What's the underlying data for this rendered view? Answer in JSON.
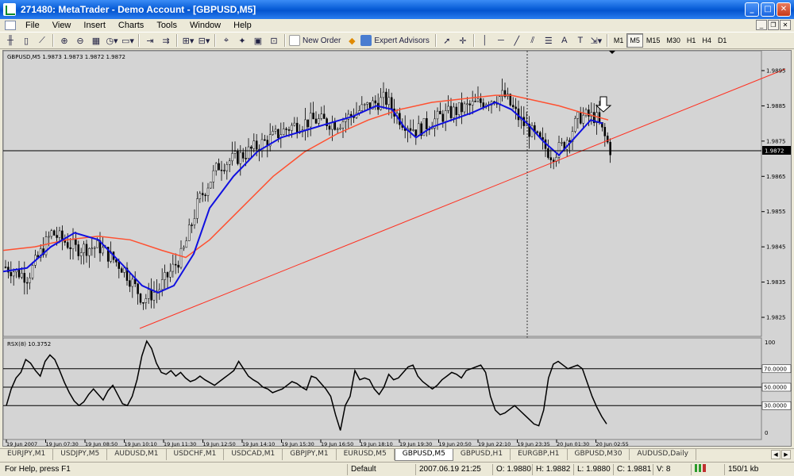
{
  "window": {
    "title": "271480: MetaTrader - Demo Account - [GBPUSD,M5]"
  },
  "menu": [
    "File",
    "View",
    "Insert",
    "Charts",
    "Tools",
    "Window",
    "Help"
  ],
  "toolbar": {
    "new_order_label": "New Order",
    "expert_advisors_label": "Expert Advisors",
    "text_tool": "A",
    "label_tool": "T",
    "timeframes": [
      "M1",
      "M5",
      "M15",
      "M30",
      "H1",
      "H4",
      "D1"
    ],
    "active_timeframe": "M5"
  },
  "chart": {
    "info": "GBPUSD,M5  1.9873 1.9873 1.9872 1.9872",
    "current_price": "1.9872",
    "price_labels": [
      {
        "label": "1.9895",
        "value": 1.9895
      },
      {
        "label": "1.9885",
        "value": 1.9885
      },
      {
        "label": "1.9875",
        "value": 1.9875
      },
      {
        "label": "1.9865",
        "value": 1.9865
      },
      {
        "label": "1.9855",
        "value": 1.9855
      },
      {
        "label": "1.9845",
        "value": 1.9845
      },
      {
        "label": "1.9835",
        "value": 1.9835
      },
      {
        "label": "1.9825",
        "value": 1.9825
      }
    ],
    "time_labels": [
      "19 Jun 2007",
      "19 Jun 07:30",
      "19 Jun 08:50",
      "19 Jun 10:10",
      "19 Jun 11:30",
      "19 Jun 12:50",
      "19 Jun 14:10",
      "19 Jun 15:30",
      "19 Jun 16:50",
      "19 Jun 18:10",
      "19 Jun 19:30",
      "19 Jun 20:50",
      "19 Jun 22:10",
      "19 Jun 23:35",
      "20 Jun 01:30",
      "20 Jun 02:55"
    ],
    "colors": {
      "background": "#d4d4d4",
      "slow_ma": "#ff5030",
      "fast_ma": "#1010e0",
      "trendline": "#ff3020",
      "candle": "#000000"
    }
  },
  "indicator": {
    "info": "RSX(8) 10.3752",
    "scale": [
      "100",
      "0"
    ],
    "levels": [
      {
        "label": "70.0000",
        "value": 70
      },
      {
        "label": "50.0000",
        "value": 50
      },
      {
        "label": "30.0000",
        "value": 30
      }
    ]
  },
  "chart_data": {
    "type": "line",
    "series": [
      {
        "name": "RSX(8)",
        "values": [
          30,
          48,
          60,
          66,
          80,
          76,
          68,
          62,
          78,
          85,
          80,
          68,
          55,
          44,
          35,
          30,
          34,
          42,
          48,
          42,
          36,
          46,
          52,
          42,
          32,
          30,
          40,
          58,
          84,
          100,
          92,
          76,
          66,
          64,
          68,
          62,
          66,
          60,
          56,
          58,
          62,
          58,
          55,
          52,
          56,
          60,
          64,
          68,
          78,
          70,
          62,
          58,
          55,
          50,
          48,
          44,
          46,
          48,
          52,
          56,
          54,
          50,
          47,
          62,
          60,
          54,
          48,
          40,
          20,
          3,
          30,
          40,
          68,
          58,
          60,
          58,
          48,
          42,
          50,
          64,
          58,
          60,
          66,
          72,
          74,
          62,
          56,
          52,
          48,
          52,
          58,
          62,
          66,
          64,
          60,
          68,
          70,
          72,
          74,
          66,
          40,
          25,
          20,
          22,
          26,
          30,
          25,
          20,
          15,
          10,
          8,
          25,
          60,
          75,
          78,
          74,
          70,
          72,
          74,
          70,
          55,
          40,
          28,
          18,
          10
        ]
      }
    ],
    "ylim": [
      0,
      100
    ]
  },
  "tabs": [
    "EURJPY,M1",
    "USDJPY,M5",
    "AUDUSD,M1",
    "USDCHF,M1",
    "USDCAD,M1",
    "GBPJPY,M1",
    "EURUSD,M5",
    "GBPUSD,M5",
    "GBPUSD,H1",
    "EURGBP,H1",
    "GBPUSD,M30",
    "AUDUSD,Daily"
  ],
  "active_tab": "GBPUSD,M5",
  "status": {
    "help": "For Help, press F1",
    "profile": "Default",
    "datetime": "2007.06.19 21:25",
    "open": "O: 1.9880",
    "high": "H: 1.9882",
    "low": "L: 1.9880",
    "close": "C: 1.9881",
    "volume": "V: 8",
    "traffic": "150/1 kb"
  }
}
